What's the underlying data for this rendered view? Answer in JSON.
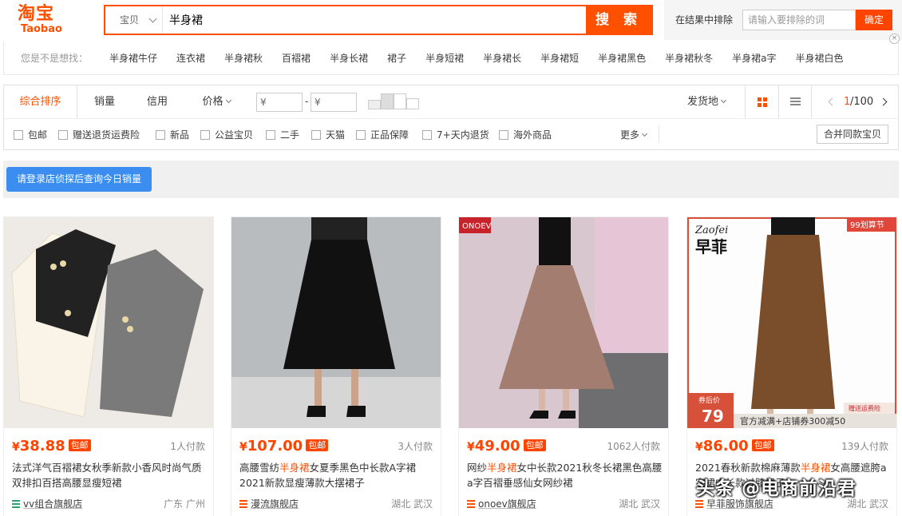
{
  "logo": {
    "cn": "淘宝",
    "en": "Taobao"
  },
  "search": {
    "type": "宝贝",
    "query": "半身裙",
    "button": "搜 索"
  },
  "exclude": {
    "label": "在结果中排除",
    "placeholder": "请输入要排除的词",
    "button": "确定",
    "close": "×"
  },
  "suggest": {
    "label": "您是不是想找：",
    "items": [
      "半身裙牛仔",
      "连衣裙",
      "半身裙秋",
      "百褶裙",
      "半身长裙",
      "裙子",
      "半身短裙",
      "半身裙长",
      "半身裙短",
      "半身裙黑色",
      "半身裙秋冬",
      "半身裙a字",
      "半身裙白色"
    ]
  },
  "sort": {
    "tabs": [
      "综合排序",
      "销量",
      "信用",
      "价格"
    ],
    "price_min": "¥",
    "price_max": "¥",
    "dash": "-",
    "ship_from": "发货地",
    "page_current": "1",
    "page_total": "/100"
  },
  "filters": {
    "items": [
      "包邮",
      "赠送退货运费险",
      "新品",
      "公益宝贝",
      "二手",
      "天猫",
      "正品保障",
      "7+天内退货",
      "海外商品"
    ],
    "more": "更多",
    "merge": "合并同款宝贝"
  },
  "banner": {
    "button": "请登录店侦探后查询今日销量"
  },
  "products": [
    {
      "price": "38.88",
      "yen": "¥",
      "tag": "包邮",
      "paid": "1人付款",
      "title_pre": "法式洋气百褶裙女秋季新款小香风时尚气质双排扣百搭高腰显瘦短裙",
      "title_hl": "",
      "title_post": "",
      "shop": "vv组合旗舰店",
      "loc": "广东 广州"
    },
    {
      "price": "107.00",
      "yen": "¥",
      "tag": "包邮",
      "paid": "3人付款",
      "title_pre": "高腰雪纺",
      "title_hl": "半身裙",
      "title_post": "女夏季黑色中长款A字裙2021新款显瘦薄款大摆裙子",
      "shop": "漫流旗舰店",
      "loc": "湖北 武汉"
    },
    {
      "price": "49.00",
      "yen": "¥",
      "tag": "包邮",
      "paid": "1062人付款",
      "title_pre": "网纱",
      "title_hl": "半身裙",
      "title_post": "女中长款2021秋冬长裙黑色高腰a字百褶垂感仙女网纱裙",
      "shop": "onoev旗舰店",
      "loc": "湖北 武汉",
      "img_brand": "ONOEV"
    },
    {
      "price": "86.00",
      "yen": "¥",
      "tag": "包邮",
      "paid": "139人付款",
      "title_pre": "2021春秋新款棉麻薄款",
      "title_hl": "半身裙",
      "title_post": "女高腰遮胯a字裙中长款过膝裙子",
      "shop": "早菲服饰旗舰店",
      "loc": "湖北 武汉",
      "img_brand": "Zaofei",
      "img_brand_cn": "早菲",
      "img_badge": "99划算节",
      "img_price_label": "券后价",
      "img_price": "79",
      "img_strip": "官方减满+店铺券300减50",
      "img_return": "赠送运费险"
    }
  ],
  "watermark": "头条 @电商前沿君",
  "colors": {
    "accent": "#ff5000",
    "price": "#ff4400",
    "banner_btn": "#3b8ef0"
  }
}
